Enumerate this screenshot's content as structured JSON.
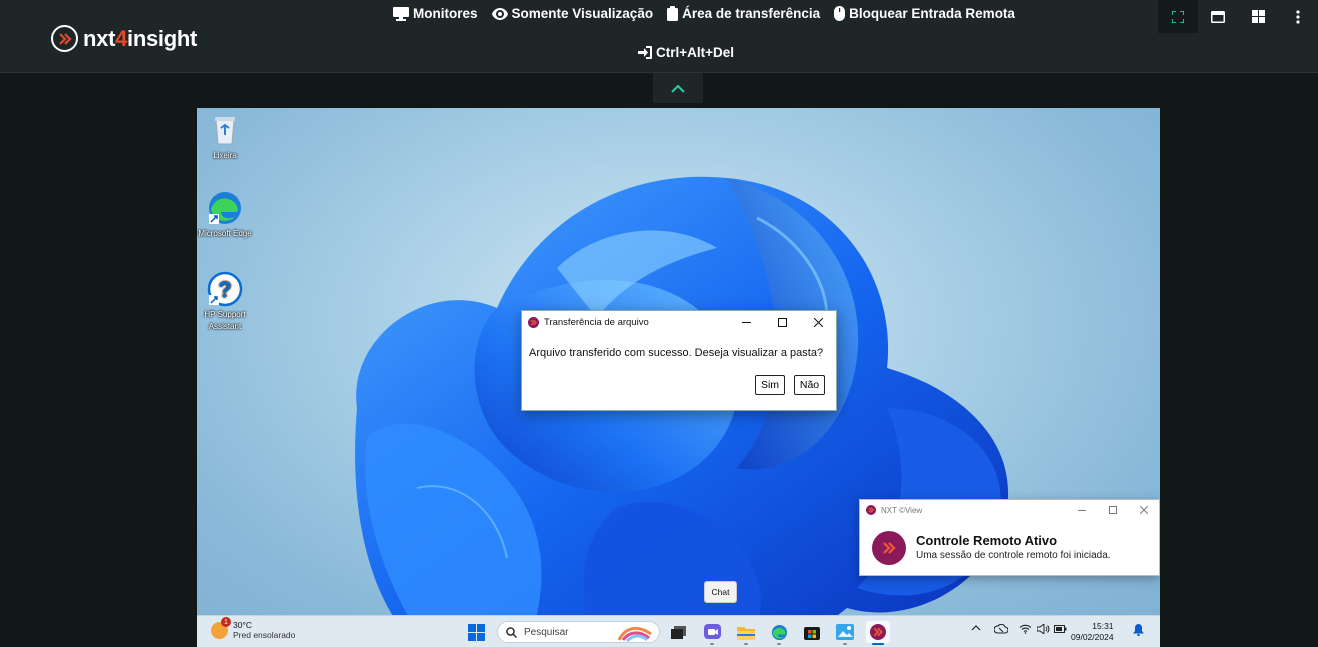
{
  "app": {
    "logo": {
      "prefix": "nxt",
      "accent": "4",
      "suffix": "insight"
    },
    "menu": [
      {
        "label": "Monitores",
        "icon": "monitor-icon"
      },
      {
        "label": "Somente Visualização",
        "icon": "eye-icon"
      },
      {
        "label": "Área de transferência",
        "icon": "clipboard-icon"
      },
      {
        "label": "Bloquear Entrada Remota",
        "icon": "mouse-icon"
      }
    ],
    "cad_label": "Ctrl+Alt+Del",
    "right_tools": [
      "fullscreen-icon",
      "window-icon",
      "windows-logo-icon",
      "more-icon"
    ],
    "colors": {
      "accent": "#e2492a",
      "active_tool": "#2ac8a0",
      "brand": "#8a1a5a"
    }
  },
  "desktop": {
    "icons": [
      {
        "label": "Lixeira",
        "icon": "recycle-bin-icon"
      },
      {
        "label": "Microsoft Edge",
        "icon": "edge-icon"
      },
      {
        "label": "HP Support Assistant",
        "icon": "hp-support-icon"
      }
    ],
    "dialog": {
      "title": "Transferência de arquivo",
      "message": "Arquivo transferido com sucesso.  Deseja visualizar a pasta?",
      "yes_label": "Sim",
      "no_label": "Não"
    },
    "toast": {
      "app_name": "NXT ©View",
      "title": "Controle Remoto Ativo",
      "text": "Uma sessão de controle remoto foi iniciada."
    },
    "tooltip": "Chat",
    "taskbar": {
      "weather": {
        "temp": "30°C",
        "desc": "Pred ensolarado",
        "badge": "1"
      },
      "search_placeholder": "Pesquisar",
      "apps": [
        "task-view-icon",
        "teams-icon",
        "file-explorer-icon",
        "edge-icon",
        "store-icon",
        "photos-icon",
        "nxt-view-icon"
      ],
      "time": "15:31",
      "date": "09/02/2024"
    }
  }
}
